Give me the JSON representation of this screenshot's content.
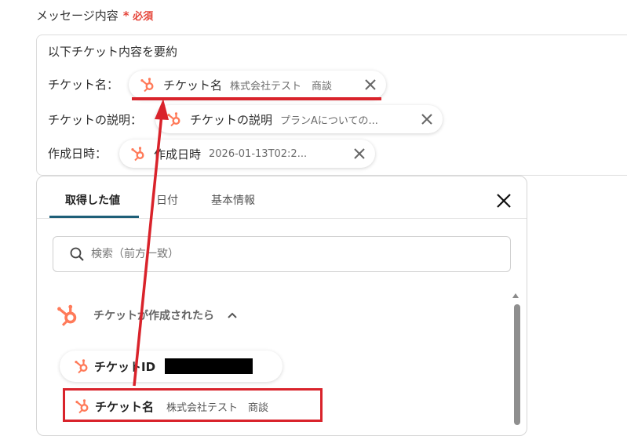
{
  "field": {
    "label": "メッセージ内容",
    "required_mark": "*",
    "required_text": "必須"
  },
  "message": {
    "line1": "以下チケット内容を要約",
    "rows": [
      {
        "label": "チケット名：",
        "chip_title": "チケット名",
        "chip_value": "株式会社テスト　商談"
      },
      {
        "label": "チケットの説明：",
        "chip_title": "チケットの説明",
        "chip_value": "プランAについての..."
      },
      {
        "label": "作成日時：",
        "chip_title": "作成日時",
        "chip_value": "2026-01-13T02:2..."
      }
    ]
  },
  "panel": {
    "tabs": [
      "取得した値",
      "日付",
      "基本情報"
    ],
    "active_tab": "取得した値",
    "search_placeholder": "検索（前方一致）",
    "group_title": "チケットが作成されたら",
    "items": [
      {
        "title": "チケットID",
        "value": ""
      },
      {
        "title": "チケット名",
        "value": "株式会社テスト　商談"
      }
    ]
  },
  "icons": [
    "hubspot-icon",
    "close-icon",
    "search-icon",
    "chevron-up-icon"
  ],
  "colors": {
    "accent": "#1e5f78",
    "highlight": "#d9232b",
    "hubspot": "#ff7a59",
    "required": "#e5453a"
  }
}
